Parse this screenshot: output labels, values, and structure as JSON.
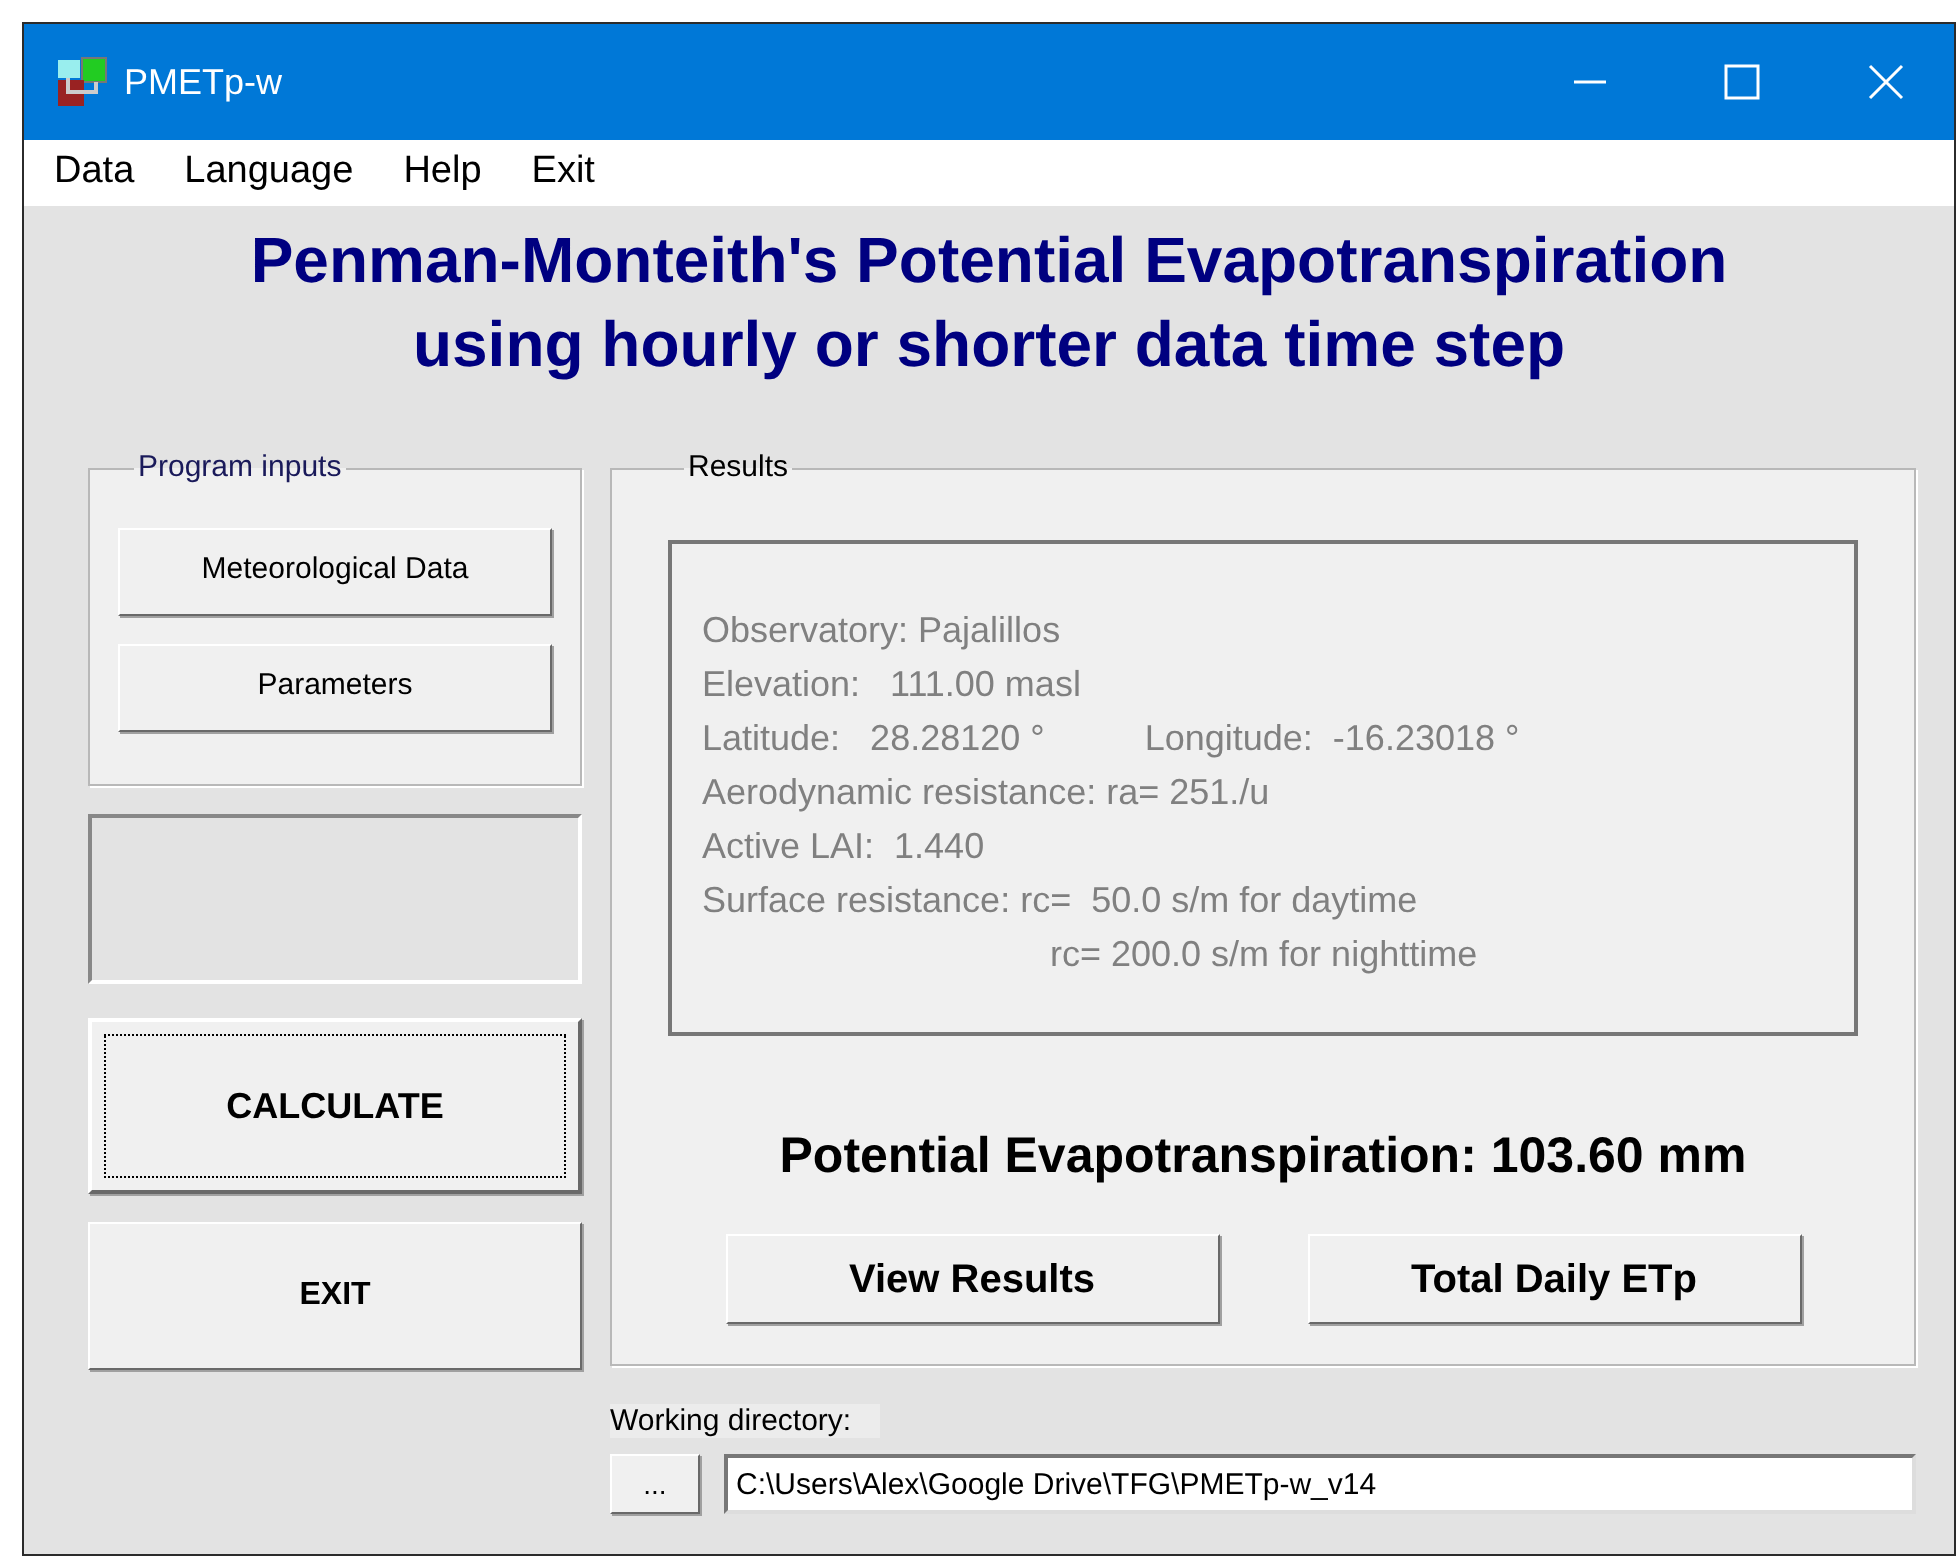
{
  "window": {
    "title": "PMETp-w"
  },
  "menu": [
    "Data",
    "Language",
    "Help",
    "Exit"
  ],
  "heading": [
    "Penman-Monteith's Potential Evapotranspiration",
    "using hourly or shorter data time step"
  ],
  "program_inputs": {
    "title": "Program inputs",
    "buttons": [
      "Meteorological Data",
      "Parameters"
    ]
  },
  "actions": [
    {
      "label": "CALCULATE",
      "focused": true,
      "kind": "large"
    },
    {
      "label": "EXIT",
      "focused": false,
      "kind": "plain"
    }
  ],
  "results": {
    "title": "Results",
    "lines": [
      {
        "kind": "text",
        "text": "Observatory: Pajalillos"
      },
      {
        "kind": "text",
        "text": "Elevation:   111.00 masl"
      },
      {
        "kind": "pair",
        "text": "Latitude:   28.28120 °",
        "text2": "Longitude:  -16.23018 °"
      },
      {
        "kind": "text",
        "text": "Aerodynamic resistance: ra= 251./u"
      },
      {
        "kind": "text",
        "text": "Active LAI:  1.440"
      },
      {
        "kind": "text",
        "text": "Surface resistance: rc=  50.0 s/m for daytime"
      },
      {
        "kind": "indent",
        "text": "rc= 200.0 s/m for nighttime"
      }
    ],
    "total": "Potential Evapotranspiration: 103.60 mm",
    "buttons": [
      "View Results",
      "Total Daily ETp"
    ]
  },
  "working_directory": {
    "label": "Working directory:",
    "browse": "...",
    "value": "C:\\Users\\Alex\\Google Drive\\TFG\\PMETp-w_v14"
  }
}
